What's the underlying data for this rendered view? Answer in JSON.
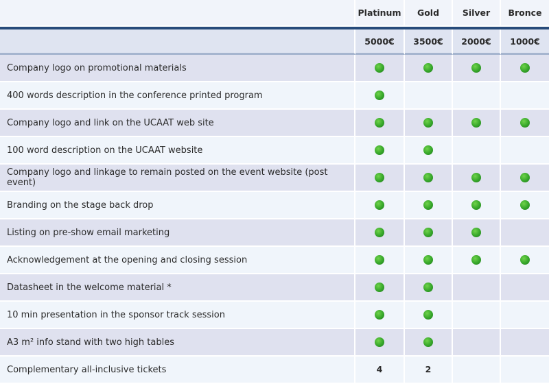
{
  "tiers": [
    {
      "name": "Platinum",
      "price": "5000€"
    },
    {
      "name": "Gold",
      "price": "3500€"
    },
    {
      "name": "Silver",
      "price": "2000€"
    },
    {
      "name": "Bronce",
      "price": "1000€"
    }
  ],
  "colors": {
    "header_bar": "#274b7a",
    "dot": "#36a62a",
    "row_odd": "#dfe1ef",
    "row_even": "#f0f5fb"
  },
  "rows": [
    {
      "label": "Company logo on promotional materials",
      "cells": [
        "dot",
        "dot",
        "dot",
        "dot"
      ]
    },
    {
      "label": "400 words description in the conference printed program",
      "cells": [
        "dot",
        "",
        "",
        ""
      ]
    },
    {
      "label": "Company logo and link on the UCAAT web site",
      "cells": [
        "dot",
        "dot",
        "dot",
        "dot"
      ]
    },
    {
      "label": "100 word description on the UCAAT website",
      "cells": [
        "dot",
        "dot",
        "",
        ""
      ]
    },
    {
      "label": "Company logo and linkage to remain posted on the event website (post event)",
      "cells": [
        "dot",
        "dot",
        "dot",
        "dot"
      ]
    },
    {
      "label": "Branding on the stage back drop",
      "cells": [
        "dot",
        "dot",
        "dot",
        "dot"
      ]
    },
    {
      "label": "Listing on pre-show email marketing",
      "cells": [
        "dot",
        "dot",
        "dot",
        ""
      ]
    },
    {
      "label": "Acknowledgement at the opening and closing session",
      "cells": [
        "dot",
        "dot",
        "dot",
        "dot"
      ]
    },
    {
      "label": "Datasheet in the welcome material *",
      "cells": [
        "dot",
        "dot",
        "",
        ""
      ]
    },
    {
      "label": "10 min presentation in the sponsor track session",
      "cells": [
        "dot",
        "dot",
        "",
        ""
      ]
    },
    {
      "label": "A3 m² info stand with two high tables",
      "cells": [
        "dot",
        "dot",
        "",
        ""
      ]
    },
    {
      "label": "Complementary all-inclusive tickets",
      "cells": [
        "4",
        "2",
        "",
        ""
      ]
    }
  ]
}
